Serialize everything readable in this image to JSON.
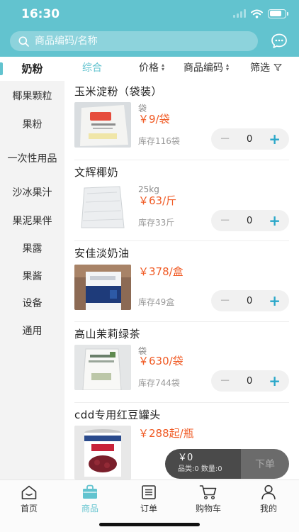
{
  "status_bar": {
    "time": "16:30"
  },
  "search": {
    "placeholder": "商品编码/名称"
  },
  "sidebar": {
    "items": [
      {
        "label": "奶粉"
      },
      {
        "label": "椰果颗粒"
      },
      {
        "label": "果粉"
      },
      {
        "label": "一次性用品"
      },
      {
        "label": "沙冰果汁"
      },
      {
        "label": "果泥果伴"
      },
      {
        "label": "果露"
      },
      {
        "label": "果酱"
      },
      {
        "label": "设备"
      },
      {
        "label": "通用"
      }
    ]
  },
  "sort_bar": {
    "comprehensive": "综合",
    "price": "价格",
    "product_code": "商品编码",
    "filter": "筛选"
  },
  "products": [
    {
      "name": "玉米淀粉（袋装）",
      "unit": "袋",
      "price": "￥9/袋",
      "stock": "库存116袋",
      "qty": "0"
    },
    {
      "name": "文辉椰奶",
      "unit": "25kg",
      "price": "￥63/斤",
      "stock": "库存33斤",
      "qty": "0"
    },
    {
      "name": "安佳淡奶油",
      "unit": "",
      "price": "￥378/盒",
      "stock": "库存49盒",
      "qty": "0"
    },
    {
      "name": "高山茉莉绿茶",
      "unit": "袋",
      "price": "￥630/袋",
      "stock": "库存744袋",
      "qty": "0"
    },
    {
      "name": "cdd专用红豆罐头",
      "unit": "",
      "price": "￥288起/瓶",
      "stock": "",
      "qty": ""
    }
  ],
  "cart": {
    "total": "￥0",
    "counts": "品类:0  数量:0",
    "order_label": "下单"
  },
  "bottom_nav": {
    "items": [
      {
        "label": "首页"
      },
      {
        "label": "商品"
      },
      {
        "label": "订单"
      },
      {
        "label": "购物车"
      },
      {
        "label": "我的"
      }
    ]
  },
  "colors": {
    "accent": "#62c3cf",
    "price": "#f05a24",
    "plus": "#2aa7c9"
  }
}
